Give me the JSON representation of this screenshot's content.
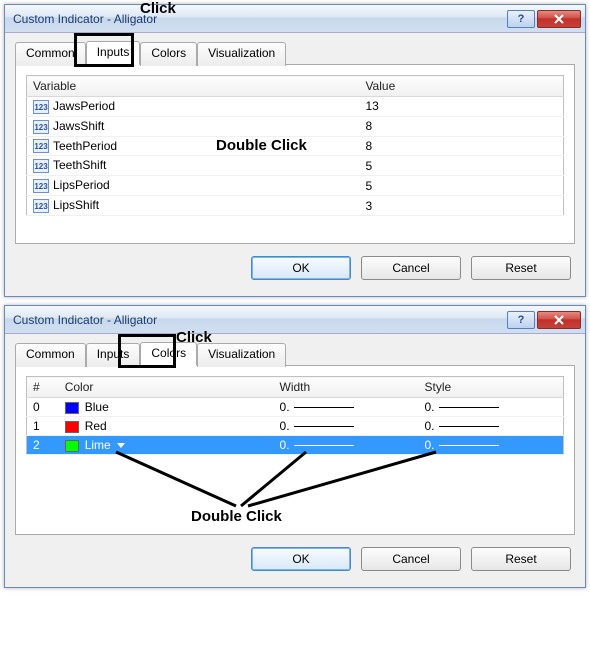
{
  "dialog1": {
    "title": "Custom Indicator - Alligator",
    "tabs": [
      "Common",
      "Inputs",
      "Colors",
      "Visualization"
    ],
    "active_tab": "Inputs",
    "columns": [
      "Variable",
      "Value"
    ],
    "rows": [
      {
        "name": "JawsPeriod",
        "value": "13"
      },
      {
        "name": "JawsShift",
        "value": "8"
      },
      {
        "name": "TeethPeriod",
        "value": "8"
      },
      {
        "name": "TeethShift",
        "value": "5"
      },
      {
        "name": "LipsPeriod",
        "value": "5"
      },
      {
        "name": "LipsShift",
        "value": "3"
      }
    ],
    "buttons": {
      "ok": "OK",
      "cancel": "Cancel",
      "reset": "Reset"
    }
  },
  "dialog2": {
    "title": "Custom Indicator - Alligator",
    "tabs": [
      "Common",
      "Inputs",
      "Colors",
      "Visualization"
    ],
    "active_tab": "Colors",
    "columns": [
      "#",
      "Color",
      "Width",
      "Style"
    ],
    "rows": [
      {
        "idx": "0",
        "color_name": "Blue",
        "hex": "#0000ff",
        "width": "0.",
        "style": "0."
      },
      {
        "idx": "1",
        "color_name": "Red",
        "hex": "#ff0000",
        "width": "0.",
        "style": "0."
      },
      {
        "idx": "2",
        "color_name": "Lime",
        "hex": "#00ff00",
        "width": "0.",
        "style": "0.",
        "selected": true
      }
    ],
    "buttons": {
      "ok": "OK",
      "cancel": "Cancel",
      "reset": "Reset"
    }
  },
  "annotations": {
    "click1": "Click",
    "dbl1": "Double Click",
    "click2": "Click",
    "dbl2": "Double Click"
  }
}
